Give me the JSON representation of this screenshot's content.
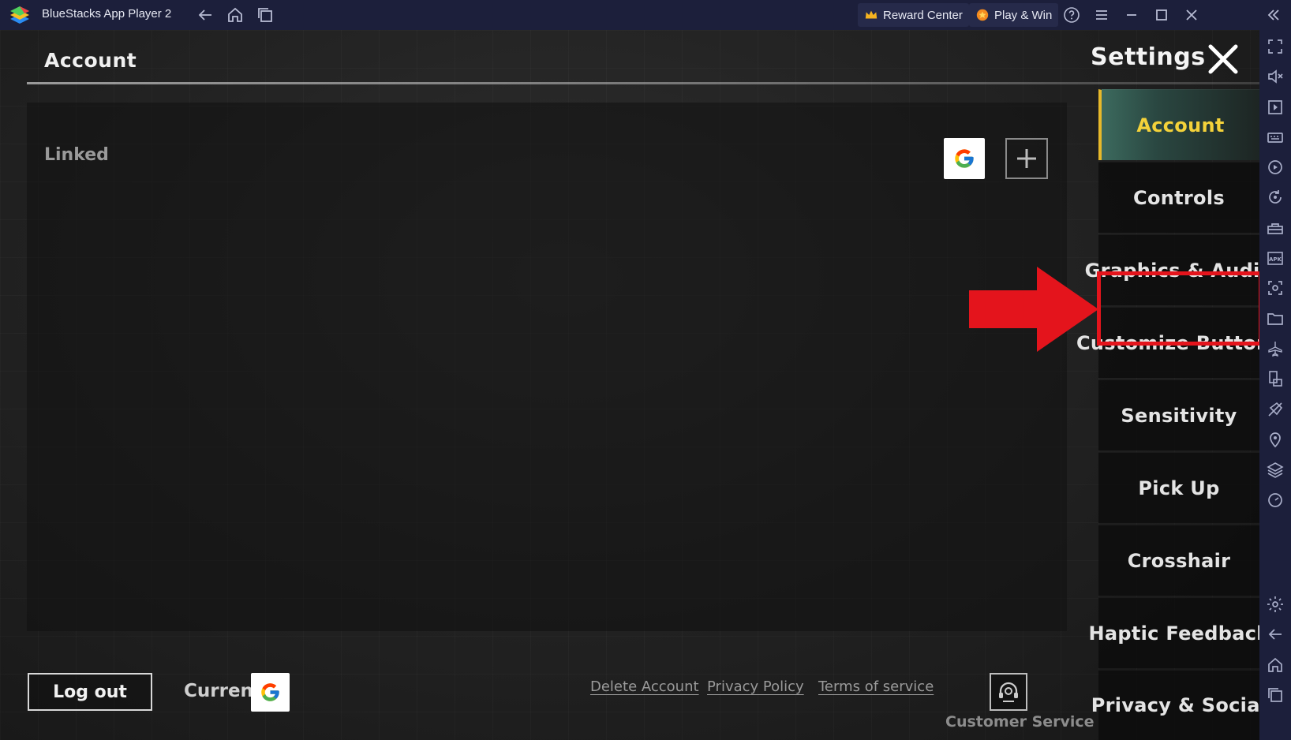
{
  "window": {
    "app_title": "BlueStacks App Player 2",
    "reward_center_label": "Reward Center",
    "play_win_label": "Play & Win"
  },
  "game": {
    "section_title": "Account",
    "settings_title": "Settings",
    "linked_label": "Linked",
    "tabs": [
      {
        "label": "Account",
        "active": true
      },
      {
        "label": "Controls",
        "active": false
      },
      {
        "label": "Graphics & Audio",
        "active": false,
        "highlighted": true
      },
      {
        "label": "Customize Buttons",
        "active": false
      },
      {
        "label": "Sensitivity",
        "active": false
      },
      {
        "label": "Pick Up",
        "active": false
      },
      {
        "label": "Crosshair",
        "active": false
      },
      {
        "label": "Haptic Feedback",
        "active": false
      },
      {
        "label": "Privacy & Social",
        "active": false
      }
    ],
    "bottom": {
      "logout_label": "Log out",
      "current_label": "Current",
      "delete_account_label": "Delete Account",
      "privacy_policy_label": "Privacy Policy",
      "terms_label": "Terms of service",
      "customer_service_label": "Customer Service"
    }
  },
  "colors": {
    "titlebar_bg": "#1c1f3b",
    "active_tab_text": "#f4d23a",
    "highlight_red": "#e4141c"
  },
  "icons": {
    "titlebar": [
      "back-arrow-icon",
      "home-icon",
      "multi-instance-icon",
      "crown-icon",
      "coin-icon",
      "help-icon",
      "menu-icon",
      "minimize-icon",
      "maximize-icon",
      "close-icon",
      "collapse-sidebar-icon"
    ],
    "sidebar": [
      "fullscreen-icon",
      "volume-icon",
      "media-player-icon",
      "keyboard-icon",
      "macro-icon",
      "rotate-icon",
      "toolbox-icon",
      "apk-icon",
      "screenshot-icon",
      "folder-icon",
      "airplane-icon",
      "multi-instance-icon",
      "eco-mode-icon",
      "location-icon",
      "layers-icon",
      "performance-icon",
      "settings-icon",
      "back-icon",
      "home-icon",
      "recent-apps-icon"
    ]
  }
}
